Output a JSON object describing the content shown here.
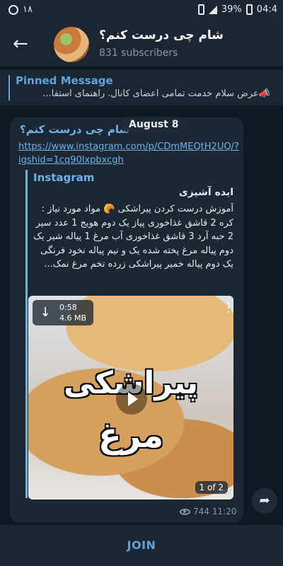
{
  "status_bar": {
    "left_text": "۱۸",
    "battery": "39%",
    "time": "04:4"
  },
  "header": {
    "title": "شام چی درست کنم؟",
    "subscribers": "831 subscribers"
  },
  "pinned": {
    "label": "Pinned Message",
    "text": "📣عرض سلام خدمت تمامی اعضای کانال. راهنمای استفا..."
  },
  "date_chip": "August 8",
  "message": {
    "author": "شام چی درست کنم؟",
    "link": "https://www.instagram.com/p/CDmMEQtH2UQ/?igshid=1cq90lxpbxcgh",
    "preview": {
      "site": "Instagram",
      "title": "ایده آشپزی",
      "description": "آموزش درست کردن پیراشکی 🥐 مواد مورد نیاز : کره 2 قاشق غذاخوری پیاز یک دوم هویج 1 عدد سیر 2 حبه آرد 3 قاشق غذاخوری آب مرغ 1 پیاله شیر یک دوم پیاله مرغ پخته شده یک و نیم پیاله نخود فرنگی یک دوم پیاله خمیر پیراشکی زرده تخم مرغ نمک..."
    },
    "video": {
      "duration": "0:58",
      "size": "4.6 MB",
      "overlay_line1": "پیراشکی",
      "overlay_line2": "مرغ",
      "counter": "1 of 2"
    },
    "views": "744",
    "time": "11:20"
  },
  "bottom": {
    "join_label": "JOIN"
  },
  "colors": {
    "accent": "#5fa3de",
    "background": "#0f1924",
    "panel": "#1b2632",
    "bubble": "#1c2734"
  }
}
